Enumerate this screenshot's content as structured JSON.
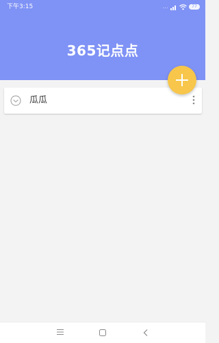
{
  "status_bar": {
    "time": "下午3:15",
    "signal_dots": "...",
    "battery_level": "77",
    "icons": [
      "signal-icon",
      "wifi-icon",
      "battery-icon"
    ]
  },
  "header": {
    "title": "365记点点",
    "background_color": "#7f92f5"
  },
  "fab": {
    "icon": "plus-icon",
    "color": "#f7c64a"
  },
  "list": {
    "items": [
      {
        "label": "瓜瓜",
        "checked": false,
        "icon": "check-circle-icon",
        "menu_icon": "more-vertical-icon"
      }
    ]
  },
  "nav_bar": {
    "buttons": [
      "menu-icon",
      "home-icon",
      "back-icon"
    ]
  }
}
